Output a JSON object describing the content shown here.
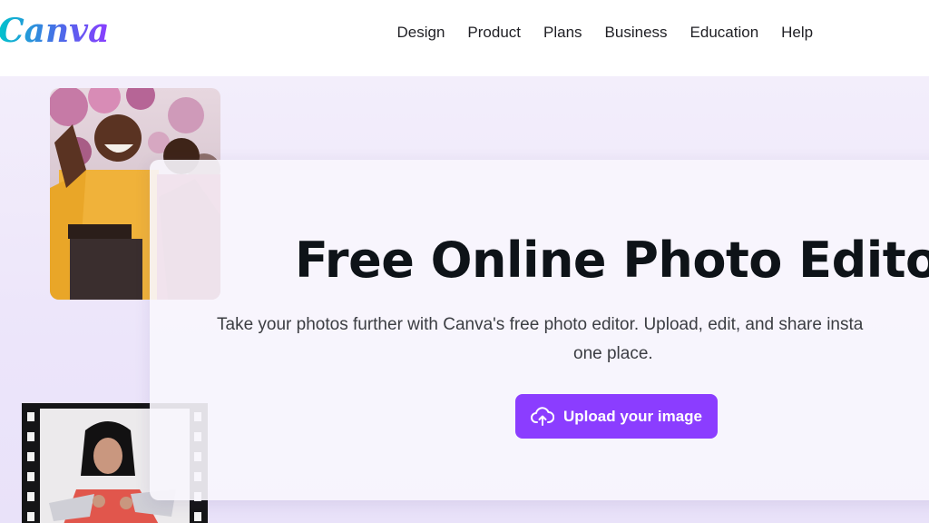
{
  "header": {
    "logo_text": "Canva",
    "nav": [
      {
        "label": "Design"
      },
      {
        "label": "Product"
      },
      {
        "label": "Plans"
      },
      {
        "label": "Business"
      },
      {
        "label": "Education"
      },
      {
        "label": "Help"
      }
    ]
  },
  "hero": {
    "title": "Free Online Photo Editor",
    "subtitle_line1": "Take your photos further with Canva's free photo editor. Upload, edit, and share insta",
    "subtitle_line2": "one place.",
    "upload_button": {
      "label": "Upload your image",
      "icon": "cloud-upload-icon"
    }
  },
  "colors": {
    "brand_purple": "#8b3dff",
    "logo_gradient_start": "#00c4cc",
    "logo_gradient_end": "#8b3dff",
    "title_text": "#0e1318",
    "hero_background": "#efe9fb"
  }
}
